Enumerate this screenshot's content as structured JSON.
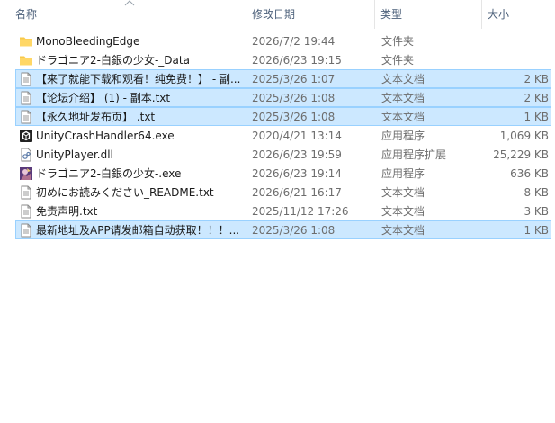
{
  "columns": {
    "name": "名称",
    "date": "修改日期",
    "type": "类型",
    "size": "大小"
  },
  "files": [
    {
      "name": "MonoBleedingEdge",
      "date": "2026/7/2 19:44",
      "type": "文件夹",
      "size": "",
      "icon": "folder-icon",
      "selected": false
    },
    {
      "name": "ドラゴニア2-白銀の少女-_Data",
      "date": "2026/6/23 19:15",
      "type": "文件夹",
      "size": "",
      "icon": "folder-icon",
      "selected": false
    },
    {
      "name": "【来了就能下载和观看！纯免费！】 - 副...",
      "date": "2025/3/26 1:07",
      "type": "文本文档",
      "size": "2 KB",
      "icon": "text-file-icon",
      "selected": true
    },
    {
      "name": "【论坛介绍】 (1) - 副本.txt",
      "date": "2025/3/26 1:08",
      "type": "文本文档",
      "size": "2 KB",
      "icon": "text-file-icon",
      "selected": true
    },
    {
      "name": "【永久地址发布页】 .txt",
      "date": "2025/3/26 1:08",
      "type": "文本文档",
      "size": "1 KB",
      "icon": "text-file-icon",
      "selected": true
    },
    {
      "name": "UnityCrashHandler64.exe",
      "date": "2020/4/21 13:14",
      "type": "应用程序",
      "size": "1,069 KB",
      "icon": "unity-exe-icon",
      "selected": false
    },
    {
      "name": "UnityPlayer.dll",
      "date": "2026/6/23 19:59",
      "type": "应用程序扩展",
      "size": "25,229 KB",
      "icon": "dll-file-icon",
      "selected": false
    },
    {
      "name": "ドラゴニア2-白銀の少女-.exe",
      "date": "2026/6/23 19:14",
      "type": "应用程序",
      "size": "636 KB",
      "icon": "game-exe-icon",
      "selected": false
    },
    {
      "name": "初めにお読みください_README.txt",
      "date": "2026/6/21 16:17",
      "type": "文本文档",
      "size": "8 KB",
      "icon": "text-file-icon",
      "selected": false
    },
    {
      "name": "免责声明.txt",
      "date": "2025/11/12 17:26",
      "type": "文本文档",
      "size": "3 KB",
      "icon": "text-file-icon",
      "selected": false
    },
    {
      "name": "最新地址及APP请发邮箱自动获取！！！...",
      "date": "2025/3/26 1:08",
      "type": "文本文档",
      "size": "1 KB",
      "icon": "text-file-icon",
      "selected": true
    }
  ]
}
